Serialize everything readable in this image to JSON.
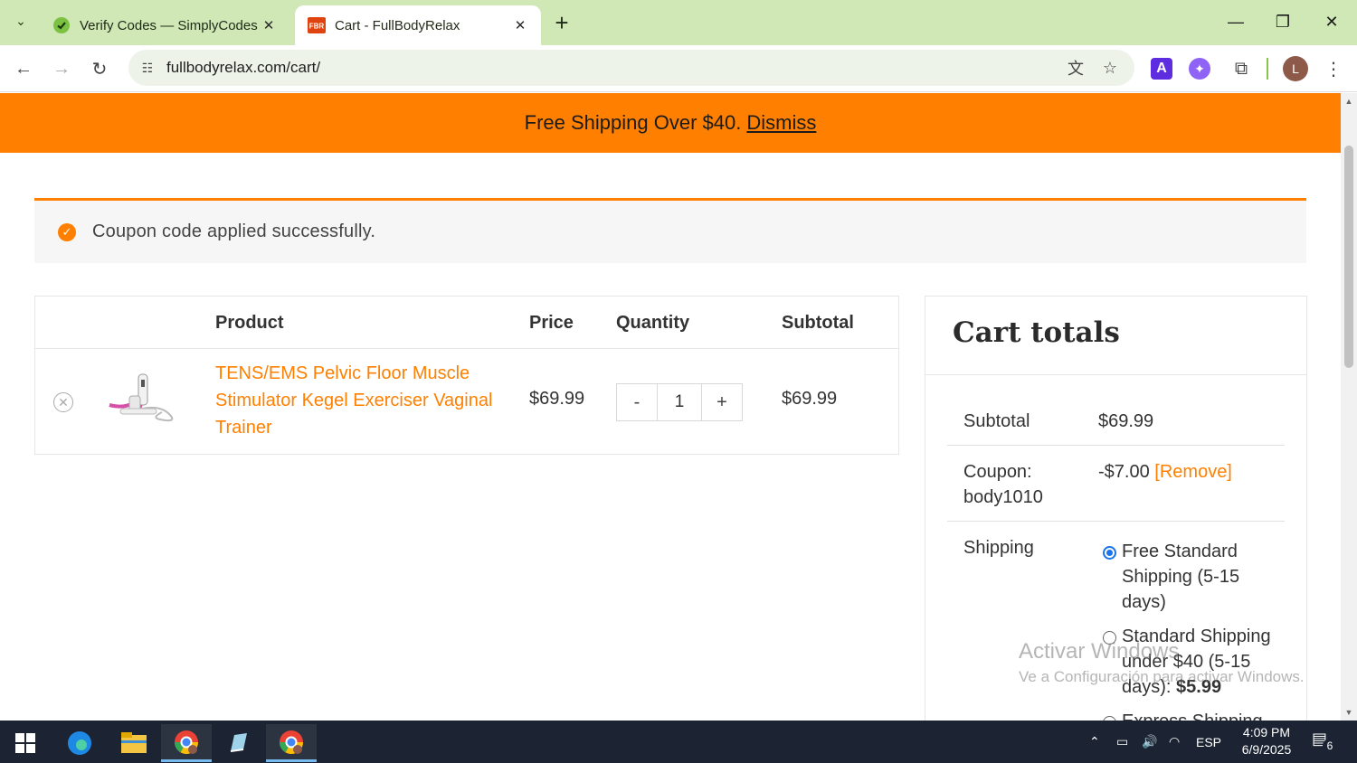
{
  "browser": {
    "tabs": [
      {
        "title": "Verify Codes — SimplyCodes",
        "icon": "simplycodes-favicon",
        "active": false
      },
      {
        "title": "Cart - FullBodyRelax",
        "icon": "fbr-favicon",
        "favicon_text": "FBR",
        "active": true
      }
    ],
    "url": "fullbodyrelax.com/cart/",
    "profile_initial": "L",
    "accent_color": "#cfe8b6"
  },
  "promo": {
    "text": "Free Shipping Over $40.",
    "dismiss_label": "Dismiss",
    "color": "#ff8001"
  },
  "notice": {
    "message": "Coupon code applied successfully."
  },
  "cart": {
    "headers": {
      "product": "Product",
      "price": "Price",
      "quantity": "Quantity",
      "subtotal": "Subtotal"
    },
    "items": [
      {
        "name": "TENS/EMS Pelvic Floor Muscle Stimulator Kegel Exerciser Vaginal Trainer",
        "price": "$69.99",
        "quantity": "1",
        "subtotal": "$69.99",
        "minus_label": "-",
        "plus_label": "+"
      }
    ]
  },
  "totals": {
    "title": "Cart totals",
    "subtotal_label": "Subtotal",
    "subtotal_value": "$69.99",
    "coupon_label": "Coupon: body1010",
    "coupon_value": "-$7.00",
    "coupon_remove": "[Remove]",
    "shipping_label": "Shipping",
    "shipping_options": [
      {
        "label": "Free Standard Shipping (5-15 days)",
        "price": "",
        "selected": true
      },
      {
        "label": "Standard Shipping under $40 (5-15 days): ",
        "price": "$5.99",
        "selected": false
      },
      {
        "label": "Express Shipping",
        "price": "",
        "selected": false
      }
    ]
  },
  "watermark": {
    "line1": "Activar Windows",
    "line2": "Ve a Configuración para activar Windows."
  },
  "taskbar": {
    "language": "ESP",
    "time": "4:09 PM",
    "date": "6/9/2025",
    "notification_count": "6"
  }
}
